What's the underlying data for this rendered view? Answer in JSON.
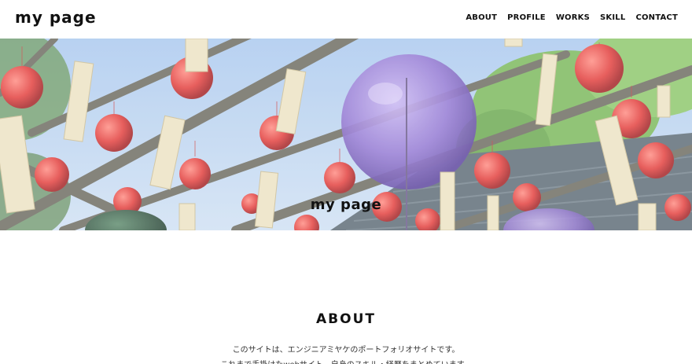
{
  "header": {
    "logo": "my page",
    "nav": [
      "ABOUT",
      "PROFILE",
      "WORKS",
      "SKILL",
      "CONTACT"
    ]
  },
  "hero": {
    "title": "my page"
  },
  "about": {
    "heading": "ABOUT",
    "lines": [
      "このサイトは、エンジニアミヤケのポートフォリオサイトです。",
      "これまで手掛けたwebサイト、自身のスキル・経歴をまとめています。"
    ]
  },
  "colors": {
    "sky": "#bcd6f0",
    "glass_red": "#e23c3a",
    "glass_purple": "#8e6fd0",
    "bamboo": "#6b6a5e",
    "foliage": "#6aa84f"
  }
}
